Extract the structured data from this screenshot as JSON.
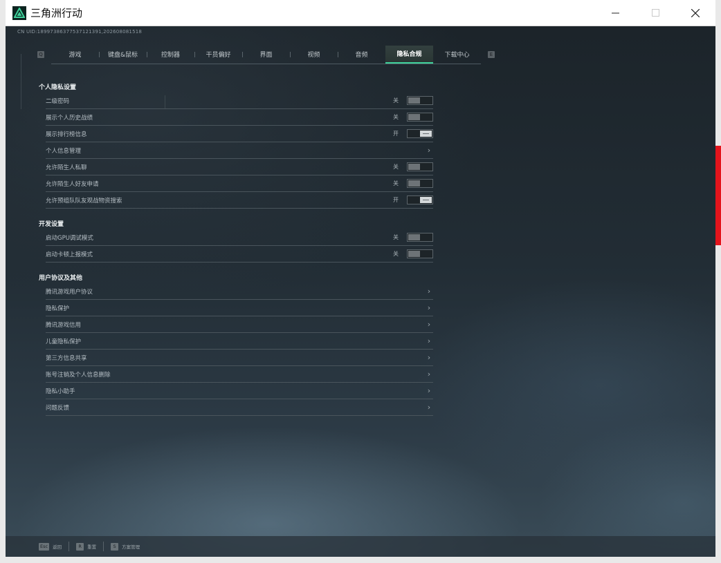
{
  "window": {
    "title": "三角洲行动"
  },
  "uid_text": "CN UID:189973863775371213​91,202608081518",
  "tabs": {
    "left_key": "Q",
    "right_key": "E",
    "items": [
      {
        "label": "游戏",
        "active": false
      },
      {
        "label": "键盘&鼠标",
        "active": false
      },
      {
        "label": "控制器",
        "active": false
      },
      {
        "label": "干员偏好",
        "active": false
      },
      {
        "label": "界面",
        "active": false
      },
      {
        "label": "视频",
        "active": false
      },
      {
        "label": "音频",
        "active": false
      },
      {
        "label": "隐私合规",
        "active": true
      },
      {
        "label": "下载中心",
        "active": false
      }
    ]
  },
  "sections": [
    {
      "title": "个人隐私设置",
      "rows": [
        {
          "label": "二级密码",
          "type": "toggle",
          "state": "关",
          "on": false
        },
        {
          "label": "展示个人历史战绩",
          "type": "toggle",
          "state": "关",
          "on": false
        },
        {
          "label": "展示排行榜信息",
          "type": "toggle",
          "state": "开",
          "on": true
        },
        {
          "label": "个人信息管理",
          "type": "link"
        },
        {
          "label": "允许陌生人私聊",
          "type": "toggle",
          "state": "关",
          "on": false
        },
        {
          "label": "允许陌生人好友申请",
          "type": "toggle",
          "state": "关",
          "on": false
        },
        {
          "label": "允许预组队队友观战物资搜索",
          "type": "toggle",
          "state": "开",
          "on": true
        }
      ]
    },
    {
      "title": "开发设置",
      "rows": [
        {
          "label": "启动GPU调试模式",
          "type": "toggle",
          "state": "关",
          "on": false
        },
        {
          "label": "启动卡顿上报模式",
          "type": "toggle",
          "state": "关",
          "on": false
        }
      ]
    },
    {
      "title": "用户协议及其他",
      "rows": [
        {
          "label": "腾讯游戏用户协议",
          "type": "link"
        },
        {
          "label": "隐私保护",
          "type": "link"
        },
        {
          "label": "腾讯游戏信用",
          "type": "link"
        },
        {
          "label": "儿童隐私保护",
          "type": "link"
        },
        {
          "label": "第三方信息共享",
          "type": "link"
        },
        {
          "label": "账号注销及个人信息删除",
          "type": "link"
        },
        {
          "label": "隐私小助手",
          "type": "link"
        },
        {
          "label": "问题反馈",
          "type": "link"
        }
      ]
    }
  ],
  "bottom_hints": [
    {
      "key": "Esc",
      "label": "返回"
    },
    {
      "key": "R",
      "label": "重置"
    },
    {
      "key": "S",
      "label": "方案管理"
    }
  ],
  "colors": {
    "accent": "#3ed29b",
    "background": "#222d35"
  }
}
